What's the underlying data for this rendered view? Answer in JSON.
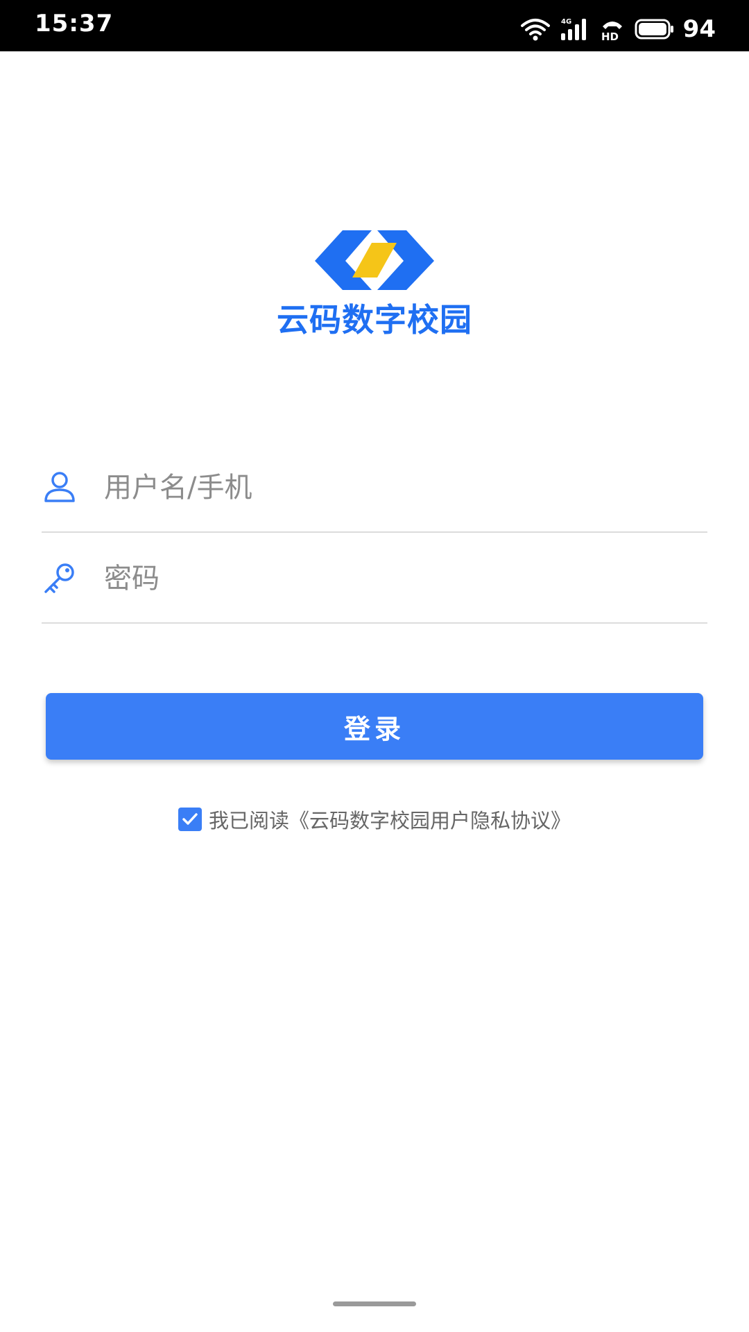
{
  "status_bar": {
    "time": "15:37",
    "network": "4G",
    "hd_label": "HD",
    "battery": "94",
    "icons": [
      "wifi-icon",
      "signal-icon",
      "hd-call-icon",
      "battery-icon"
    ]
  },
  "logo": {
    "text": "云码数字校园",
    "icon": "logo-mark-icon",
    "colors": {
      "blue": "#1f6ff2",
      "yellow": "#f5c518"
    }
  },
  "form": {
    "username": {
      "placeholder": "用户名/手机",
      "value": "",
      "icon": "user-icon"
    },
    "password": {
      "placeholder": "密码",
      "value": "",
      "icon": "key-icon"
    }
  },
  "login_button": {
    "label": "登录",
    "color": "#3a7ef6"
  },
  "agreement": {
    "checked": true,
    "text": "我已阅读《云码数字校园用户隐私协议》"
  }
}
